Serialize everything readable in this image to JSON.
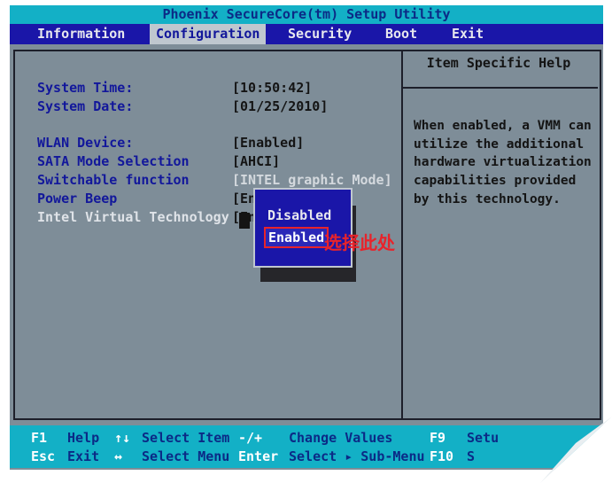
{
  "title": "Phoenix SecureCore(tm) Setup Utility",
  "menu": [
    {
      "label": "Information",
      "active": false
    },
    {
      "label": "Configuration",
      "active": true
    },
    {
      "label": "Security",
      "active": false
    },
    {
      "label": "Boot",
      "active": false
    },
    {
      "label": "Exit",
      "active": false
    }
  ],
  "settings": [
    {
      "label": "System Time:",
      "value": "[10:50:42]"
    },
    {
      "label": "System Date:",
      "value": "[01/25/2010]"
    },
    {
      "label": "WLAN Device:",
      "value": "[Enabled]"
    },
    {
      "label": "SATA Mode Selection",
      "value": "[AHCI]"
    },
    {
      "label": "Switchable function",
      "value": "[INTEL graphic Mode]"
    },
    {
      "label": "Power Beep",
      "value": "[En"
    },
    {
      "label": "Intel Virtual Technology",
      "value": "[En"
    }
  ],
  "help": {
    "header": "Item Specific Help",
    "text": "When enabled, a VMM can\nutilize the additional\nhardware virtualization\ncapabilities provided\nby this technology."
  },
  "popup": {
    "options": [
      "Disabled",
      "Enabled"
    ],
    "selected": "Enabled"
  },
  "annotation": "选择此处",
  "footer": {
    "row1": [
      {
        "key": "F1",
        "desc": "Help"
      },
      {
        "key": "↑↓",
        "desc": "Select Item"
      },
      {
        "key": "-/+",
        "desc": "Change Values"
      },
      {
        "key": "F9",
        "desc": "Setu"
      }
    ],
    "row2": [
      {
        "key": "Esc",
        "desc": "Exit"
      },
      {
        "key": "↔",
        "desc": "Select Menu"
      },
      {
        "key": "Enter",
        "desc": "Select ▸ Sub-Menu"
      },
      {
        "key": "F10",
        "desc": "S"
      }
    ]
  },
  "colors": {
    "screen_bg": "#7e8d98",
    "menu_bar": "#1a16a8",
    "title_bar": "#13b0c6",
    "label_blue": "#12179b",
    "annotation_red": "#e8232b"
  }
}
